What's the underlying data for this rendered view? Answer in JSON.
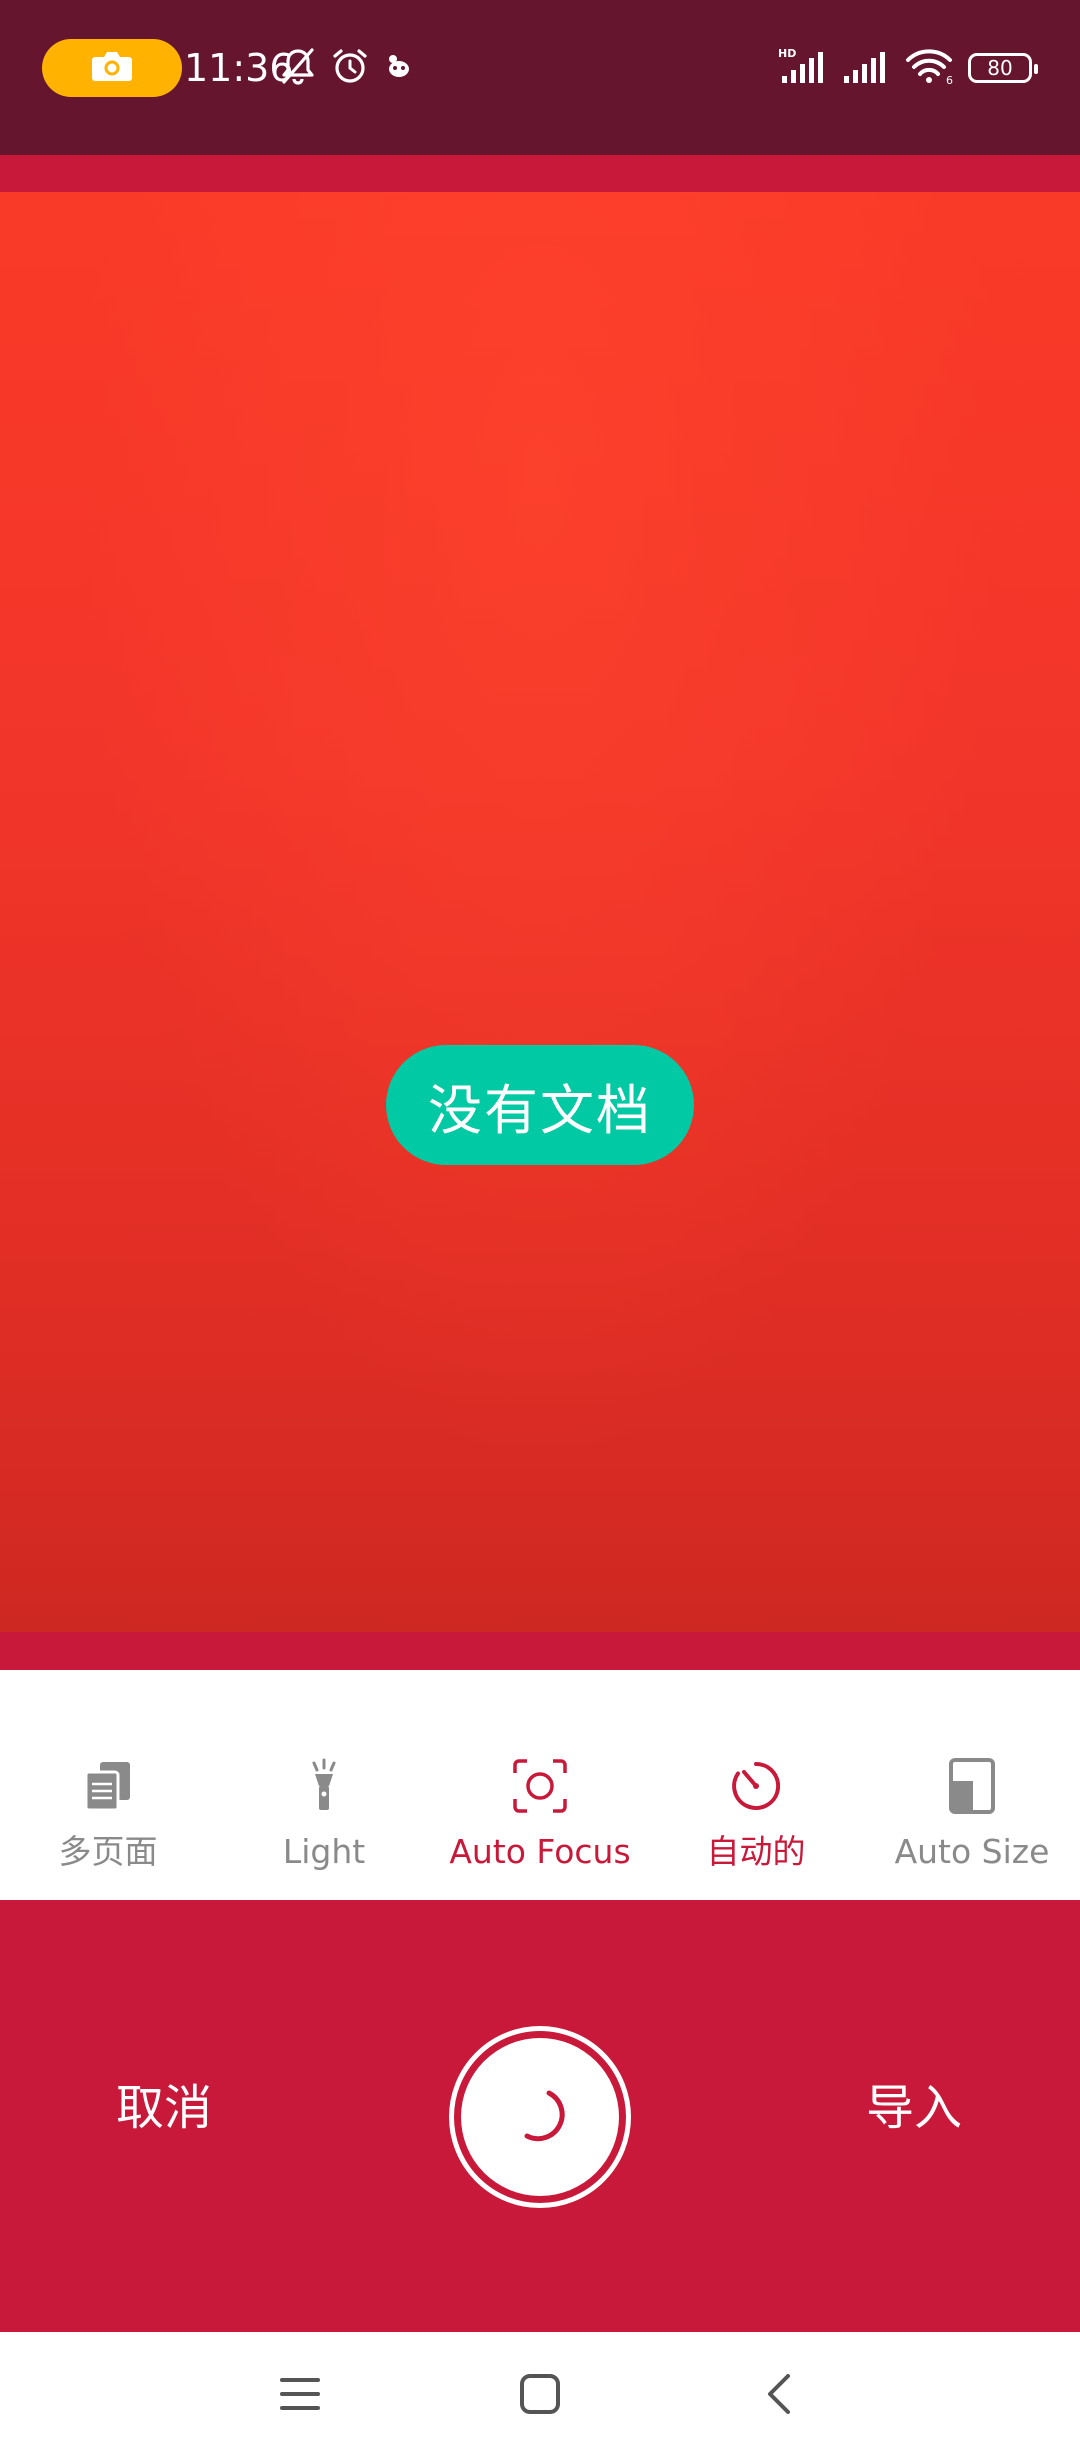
{
  "status_bar": {
    "time": "11:36",
    "battery": "80",
    "icons": [
      "camera-icon",
      "bell-off-icon",
      "alarm-icon",
      "notification-app-icon",
      "signal-hd-icon",
      "signal-icon",
      "wifi-icon",
      "battery-icon"
    ],
    "colors": {
      "background": "#66152F",
      "camera_pill": "#FFB300"
    }
  },
  "preview": {
    "empty_message": "没有文档",
    "colors": {
      "badge": "#00C9A3",
      "band": "#C8193A"
    }
  },
  "options": [
    {
      "label": "多页面",
      "icon": "multi-page-icon",
      "active": false
    },
    {
      "label": "Light",
      "icon": "flashlight-icon",
      "active": false
    },
    {
      "label": "Auto Focus",
      "icon": "focus-icon",
      "active": true
    },
    {
      "label": "自动的",
      "icon": "timer-icon",
      "active": true
    },
    {
      "label": "Auto Size",
      "icon": "page-size-icon",
      "active": false
    }
  ],
  "controls": {
    "cancel_label": "取消",
    "import_label": "导入",
    "shutter_icon": "loading-spinner-icon",
    "colors": {
      "background": "#C8193A",
      "accent": "#C8193A"
    }
  },
  "nav": {
    "icons": [
      "menu-icon",
      "home-icon",
      "back-icon"
    ]
  }
}
